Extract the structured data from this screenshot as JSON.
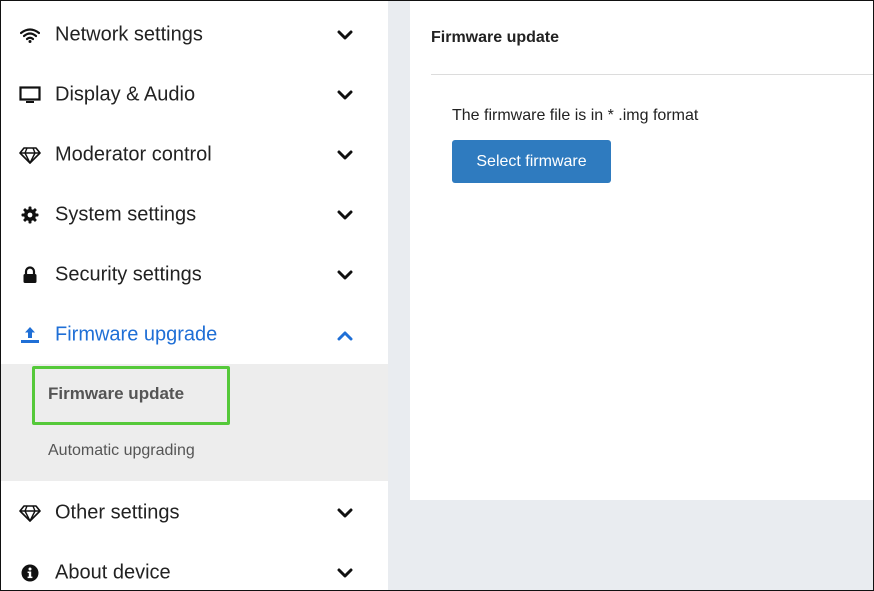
{
  "sidebar": {
    "items": [
      {
        "label": "Network settings",
        "icon": "wifi-icon",
        "expanded": false
      },
      {
        "label": "Display & Audio",
        "icon": "monitor-icon",
        "expanded": false
      },
      {
        "label": "Moderator control",
        "icon": "diamond-icon",
        "expanded": false
      },
      {
        "label": "System settings",
        "icon": "gear-icon",
        "expanded": false
      },
      {
        "label": "Security settings",
        "icon": "lock-icon",
        "expanded": false
      },
      {
        "label": "Firmware upgrade",
        "icon": "upload-icon",
        "expanded": true
      },
      {
        "label": "Other settings",
        "icon": "diamond-icon",
        "expanded": false
      },
      {
        "label": "About device",
        "icon": "info-icon",
        "expanded": false
      }
    ],
    "submenu": {
      "items": [
        {
          "label": "Firmware update",
          "selected": true
        },
        {
          "label": "Automatic upgrading",
          "selected": false
        }
      ]
    }
  },
  "main": {
    "title": "Firmware update",
    "description": "The firmware file is in * .img format",
    "select_button": "Select firmware"
  },
  "colors": {
    "accent": "#1f6fd6",
    "button": "#2f7bbf",
    "highlight": "#55c93a",
    "submenu_bg": "#ededed",
    "main_bg": "#e9ecf0"
  }
}
